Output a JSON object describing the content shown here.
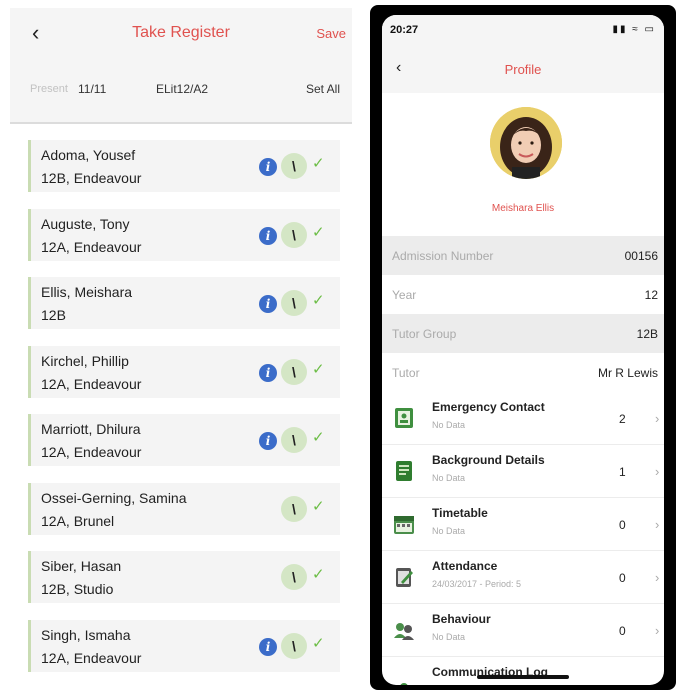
{
  "register": {
    "back_icon": "chevron-left-icon",
    "title": "Take Register",
    "save_label": "Save",
    "present_label": "Present",
    "present_count": "11/11",
    "class_code": "ELit12/A2",
    "set_all_label": "Set All",
    "colors": {
      "accent": "#e0524f",
      "info": "#3b6cc9",
      "check": "#6dbe47",
      "row_bar": "#c9dcb3"
    },
    "students": [
      {
        "name": "Adoma, Yousef",
        "group": "12B, Endeavour",
        "info": true
      },
      {
        "name": "Auguste, Tony",
        "group": "12A, Endeavour",
        "info": true
      },
      {
        "name": "Ellis, Meishara",
        "group": "12B",
        "info": true
      },
      {
        "name": "Kirchel, Phillip",
        "group": "12A, Endeavour",
        "info": true
      },
      {
        "name": "Marriott, Dhilura",
        "group": "12A, Endeavour",
        "info": true
      },
      {
        "name": "Ossei-Gerning, Samina",
        "group": "12A, Brunel",
        "info": false
      },
      {
        "name": "Siber, Hasan",
        "group": "12B, Studio",
        "info": false
      },
      {
        "name": "Singh, Ismaha",
        "group": "12A, Endeavour",
        "info": true
      }
    ]
  },
  "profile": {
    "status_time": "20:27",
    "title": "Profile",
    "name": "Meishara Ellis",
    "fields": [
      {
        "label": "Admission Number",
        "value": "00156"
      },
      {
        "label": "Year",
        "value": "12"
      },
      {
        "label": "Tutor Group",
        "value": "12B"
      },
      {
        "label": "Tutor",
        "value": "Mr R Lewis"
      }
    ],
    "sections": [
      {
        "title": "Emergency Contact",
        "subtitle": "No Data",
        "count": "2",
        "icon": "contact-book-icon"
      },
      {
        "title": "Background Details",
        "subtitle": "No Data",
        "count": "1",
        "icon": "document-icon"
      },
      {
        "title": "Timetable",
        "subtitle": "No Data",
        "count": "0",
        "icon": "calendar-icon"
      },
      {
        "title": "Attendance",
        "subtitle": "24/03/2017 - Period: 5",
        "count": "0",
        "icon": "clipboard-icon"
      },
      {
        "title": "Behaviour",
        "subtitle": "No Data",
        "count": "0",
        "icon": "people-icon"
      },
      {
        "title": "Communication Log",
        "subtitle": "",
        "count": "",
        "icon": "message-icon"
      }
    ]
  }
}
